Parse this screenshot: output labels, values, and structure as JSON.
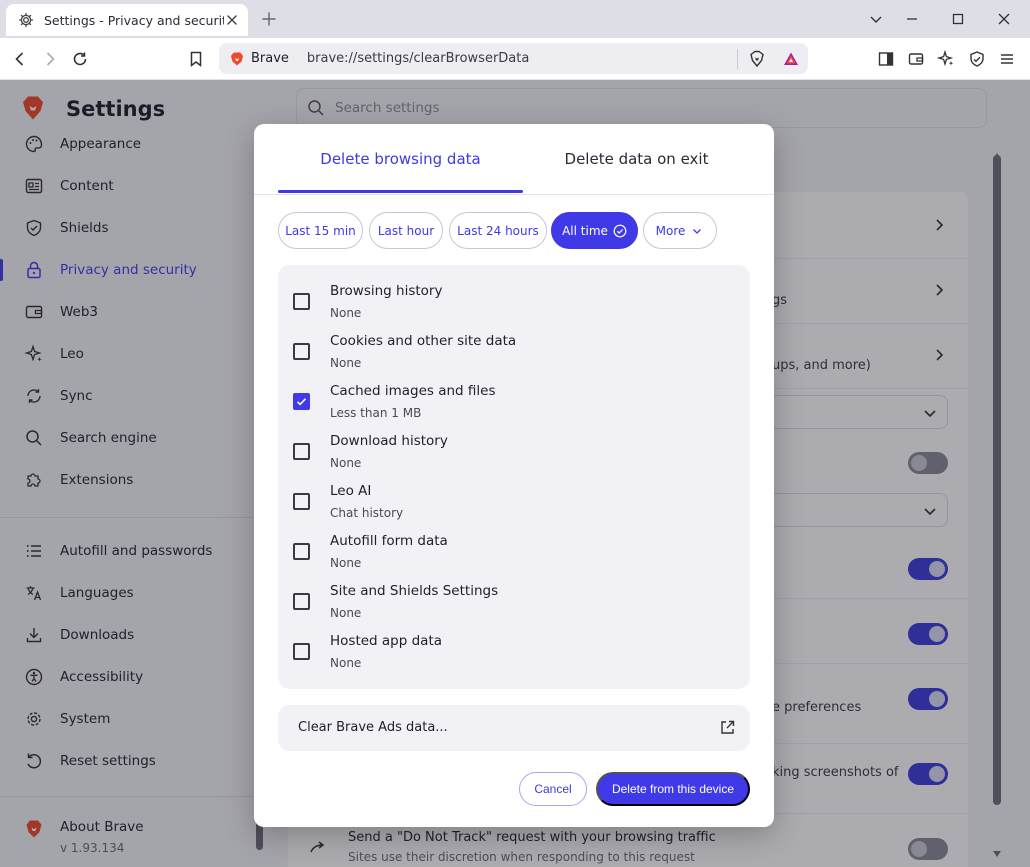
{
  "browser": {
    "tab_title": "Settings - Privacy and security",
    "site_label": "Brave",
    "url": "brave://settings/clearBrowserData"
  },
  "settings": {
    "title": "Settings",
    "search_placeholder": "Search settings",
    "nav": [
      {
        "label": "Appearance",
        "icon": "palette-icon"
      },
      {
        "label": "Content",
        "icon": "content-icon"
      },
      {
        "label": "Shields",
        "icon": "shield-icon"
      },
      {
        "label": "Privacy and security",
        "icon": "lock-icon",
        "active": true
      },
      {
        "label": "Web3",
        "icon": "wallet-icon"
      },
      {
        "label": "Leo",
        "icon": "leo-icon"
      },
      {
        "label": "Sync",
        "icon": "sync-icon"
      },
      {
        "label": "Search engine",
        "icon": "search-icon"
      },
      {
        "label": "Extensions",
        "icon": "puzzle-icon"
      },
      {
        "label": "Autofill and passwords",
        "icon": "list-icon"
      },
      {
        "label": "Languages",
        "icon": "translate-icon"
      },
      {
        "label": "Downloads",
        "icon": "download-icon"
      },
      {
        "label": "Accessibility",
        "icon": "accessibility-icon"
      },
      {
        "label": "System",
        "icon": "gear-icon"
      },
      {
        "label": "Reset settings",
        "icon": "reset-icon"
      }
    ],
    "about": {
      "label": "About Brave",
      "version": "v 1.93.134"
    },
    "background": {
      "partial_1": "gs",
      "partial_2": "ups, and more)",
      "partial_3": "e preferences",
      "partial_4": "king screenshots of",
      "dnt_title": "Send a \"Do Not Track\" request with your browsing traffic",
      "dnt_desc": "Sites use their discretion when responding to this request",
      "toggles": [
        false,
        true,
        true,
        true,
        true,
        false
      ]
    }
  },
  "dialog": {
    "tabs": [
      "Delete browsing data",
      "Delete data on exit"
    ],
    "active_tab": 0,
    "time_ranges": [
      "Last 15 min",
      "Last hour",
      "Last 24 hours",
      "All time",
      "More"
    ],
    "selected_range": 3,
    "options": [
      {
        "title": "Browsing history",
        "sub": "None",
        "checked": false
      },
      {
        "title": "Cookies and other site data",
        "sub": "None",
        "checked": false
      },
      {
        "title": "Cached images and files",
        "sub": "Less than 1 MB",
        "checked": true
      },
      {
        "title": "Download history",
        "sub": "None",
        "checked": false
      },
      {
        "title": "Leo AI",
        "sub": "Chat history",
        "checked": false
      },
      {
        "title": "Autofill form data",
        "sub": "None",
        "checked": false
      },
      {
        "title": "Site and Shields Settings",
        "sub": "None",
        "checked": false
      },
      {
        "title": "Hosted app data",
        "sub": "None",
        "checked": false
      }
    ],
    "clear_ads_label": "Clear Brave Ads data...",
    "cancel_label": "Cancel",
    "delete_label": "Delete from this device"
  },
  "colors": {
    "accent": "#3f39e8",
    "active_nav": "#423eee"
  }
}
